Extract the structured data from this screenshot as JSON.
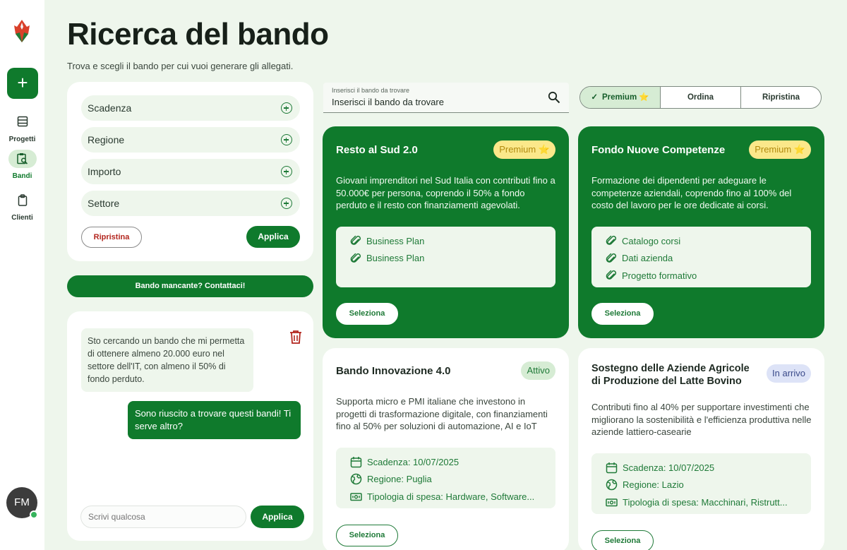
{
  "sidebar": {
    "add_label": "+",
    "items": [
      {
        "label": "Progetti",
        "icon": "list-icon"
      },
      {
        "label": "Bandi",
        "icon": "document-search-icon"
      },
      {
        "label": "Clienti",
        "icon": "clipboard-icon"
      }
    ],
    "avatar_initials": "FM"
  },
  "header": {
    "title": "Ricerca del bando",
    "subtitle": "Trova e scegli il bando per cui vuoi generare gli allegati."
  },
  "filters": {
    "rows": [
      "Scadenza",
      "Regione",
      "Importo",
      "Settore"
    ],
    "reset_label": "Ripristina",
    "apply_label": "Applica"
  },
  "contact_label": "Bando mancante? Contattaci!",
  "chat": {
    "messages": [
      {
        "from": "user",
        "text": "Sto cercando un bando che mi permetta di ottenere almeno 20.000 euro nel settore dell'IT, con almeno il 50% di fondo perduto."
      },
      {
        "from": "assistant",
        "text": "Sono riuscito a trovare questi bandi! Ti serve altro?"
      }
    ],
    "input_placeholder": "Scrivi qualcosa",
    "send_label": "Applica"
  },
  "search": {
    "label": "Inserisci il bando da trovare",
    "value": "Inserisci il bando da trovare"
  },
  "segmented": {
    "premium": "Premium ⭐",
    "check": "✓",
    "order": "Ordina",
    "reset": "Ripristina"
  },
  "cards": [
    {
      "title": "Resto al Sud 2.0",
      "badge": "Premium ⭐",
      "description": "Giovani imprenditori nel Sud Italia con contributi fino a 50.000€ per persona, coprendo il 50% a fondo perduto e il resto con finanziamenti agevolati.",
      "attachments": [
        "Business Plan",
        "Business Plan"
      ],
      "select_label": "Seleziona"
    },
    {
      "title": "Fondo Nuove Competenze",
      "badge": "Premium ⭐",
      "description": "Formazione dei dipendenti per adeguare le competenze aziendali, coprendo fino al 100% del costo del lavoro per le ore dedicate ai corsi.",
      "attachments": [
        "Catalogo corsi",
        "Dati azienda",
        "Progetto formativo"
      ],
      "select_label": "Seleziona"
    },
    {
      "title": "Bando Innovazione 4.0",
      "badge": "Attivo",
      "description": "Supporta micro e PMI italiane che investono in progetti di trasformazione digitale, con finanziamenti fino al 50% per soluzioni di automazione, AI e IoT",
      "details": [
        "Scadenza: 10/07/2025",
        "Regione: Puglia",
        "Tipologia di spesa: Hardware, Software..."
      ],
      "select_label": "Seleziona"
    },
    {
      "title": "Sostegno delle Aziende Agricole di Produzione del Latte Bovino",
      "badge": "In arrivo",
      "description": "Contributi fino al 40% per supportare investimenti che migliorano la sostenibilità e l'efficienza produttiva nelle aziende lattiero-casearie",
      "details": [
        "Scadenza: 10/07/2025",
        "Regione: Lazio",
        "Tipologia di spesa: Macchinari, Ristrutt..."
      ],
      "select_label": "Seleziona"
    }
  ]
}
